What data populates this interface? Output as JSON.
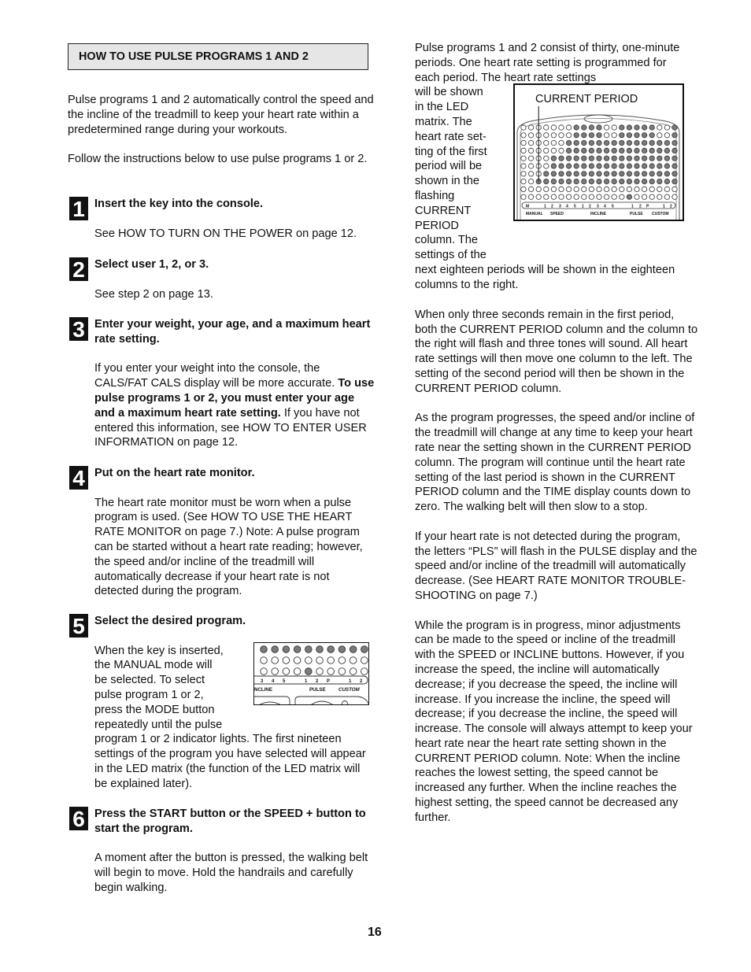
{
  "header": {
    "title": "HOW TO USE PULSE PROGRAMS 1 AND 2"
  },
  "intro": [
    "Pulse programs 1 and 2 automatically control the speed and the incline of the treadmill to keep your heart rate within a predetermined range during your workouts.",
    "Follow the instructions below to use pulse programs 1 or 2."
  ],
  "steps": [
    {
      "num": "1",
      "heading": "Insert the key into the console.",
      "body": "See HOW TO TURN ON THE POWER on page 12."
    },
    {
      "num": "2",
      "heading": "Select user 1, 2, or 3.",
      "body": "See step 2 on page 13."
    },
    {
      "num": "3",
      "heading": "Enter your weight, your age, and a maximum heart rate setting.",
      "body_pre": "If you enter your weight into the console, the CALS/FAT CALS display will be more accurate. ",
      "body_bold": "To use pulse programs 1 or 2, you must enter your age and a maximum heart rate setting.",
      "body_post": " If you have not entered this information, see HOW TO ENTER USER INFORMATION on page 12."
    },
    {
      "num": "4",
      "heading": "Put on the heart rate monitor.",
      "body": "The heart rate monitor must be worn when a pulse program is used. (See HOW TO USE THE HEART RATE MONITOR on page 7.) Note: A pulse program can be started without a heart rate reading; however, the speed and/or incline of the treadmill will automatically decrease if your heart rate is not detected during the program."
    },
    {
      "num": "5",
      "heading": "Select the desired program.",
      "body_lines": [
        "When the key is inserted,",
        "the MANUAL mode will",
        "be selected. To select",
        "pulse program 1 or 2,",
        "press the MODE button",
        "repeatedly until the pulse"
      ],
      "body_rest": "program 1 or 2 indicator lights. The first nineteen settings of the program you have selected will appear in the LED matrix (the function of the LED matrix will be explained later)."
    },
    {
      "num": "6",
      "heading": "Press the START button or the SPEED + button to start the program.",
      "body": "A moment after the button is pressed, the walking belt will begin to move. Hold the handrails and carefully begin walking."
    }
  ],
  "right": {
    "p1_top": "Pulse programs 1 and 2 consist of thirty, one-minute periods. One heart rate setting is programmed for each period. The heart rate settings",
    "p1_float_lines": [
      "will be shown",
      "in the LED",
      "matrix. The",
      "heart rate set-",
      "ting of the first",
      "period will be",
      "shown in the",
      "flashing",
      "CURRENT",
      "PERIOD",
      "column. The",
      "settings of the"
    ],
    "p1_rest": "next eighteen periods will be shown in the eighteen columns to the right.",
    "p2": "When only three seconds remain in the first period, both the CURRENT PERIOD column and the column to the right will flash and three tones will sound. All heart rate settings will then move one column to the left. The setting of the second period will then be shown in the CURRENT PERIOD column.",
    "p3": "As the program progresses, the speed and/or incline of the treadmill will change at any time to keep your heart rate near the setting shown in the CURRENT PERIOD column. The program will continue until the heart rate setting of the last period is shown in the CURRENT PERIOD column and the TIME display counts down to zero. The walking belt will then slow to a stop.",
    "p4": "If your heart rate is not detected during the program, the letters “PLS” will flash in the PULSE display and the speed and/or incline of the treadmill will automatically decrease. (See HEART RATE MONITOR TROUBLE-SHOOTING on page 7.)",
    "p5": "While the program is in progress, minor adjustments can be made to the speed or incline of the treadmill with the SPEED or INCLINE buttons. However, if you increase the speed, the incline will automatically decrease; if you decrease the speed, the incline will increase. If you increase the incline, the speed will decrease; if you decrease the incline, the speed will increase. The console will always attempt to keep your heart rate near the heart rate setting shown in the CURRENT PERIOD column. Note: When the incline reaches the lowest setting, the speed cannot be increased any further. When the incline reaches the highest setting, the speed cannot be decreased any further."
  },
  "figure_main": {
    "callout": "CURRENT PERIOD",
    "columns": 21,
    "rows": 10,
    "column_levels": [
      0,
      0,
      1,
      2,
      4,
      4,
      6,
      8,
      8,
      8,
      8,
      6,
      6,
      8,
      8,
      8,
      8,
      8,
      6,
      6,
      8
    ],
    "current_column": 3,
    "indicator_labels": [
      "M",
      "1",
      "2",
      "3",
      "4",
      "5",
      "1",
      "2",
      "3",
      "4",
      "5",
      "1",
      "2",
      "P",
      "1",
      "2"
    ],
    "group_labels": [
      "MANUAL",
      "SPEED",
      "INCLINE",
      "PULSE",
      "CUSTOM"
    ],
    "lit_indicator": "PULSE 1"
  },
  "figure_step5": {
    "indicator_labels": [
      "3",
      "4",
      "5",
      "1",
      "2",
      "P",
      "1",
      "2"
    ],
    "group_labels": [
      "NCLINE",
      "PULSE",
      "CUSTOM"
    ],
    "lit_indicator": "PULSE 1"
  },
  "colors": {
    "led_on": "#7a7a7a",
    "led_off": "#ffffff",
    "title_bg": "#e6e6e6"
  },
  "page_number": "16"
}
